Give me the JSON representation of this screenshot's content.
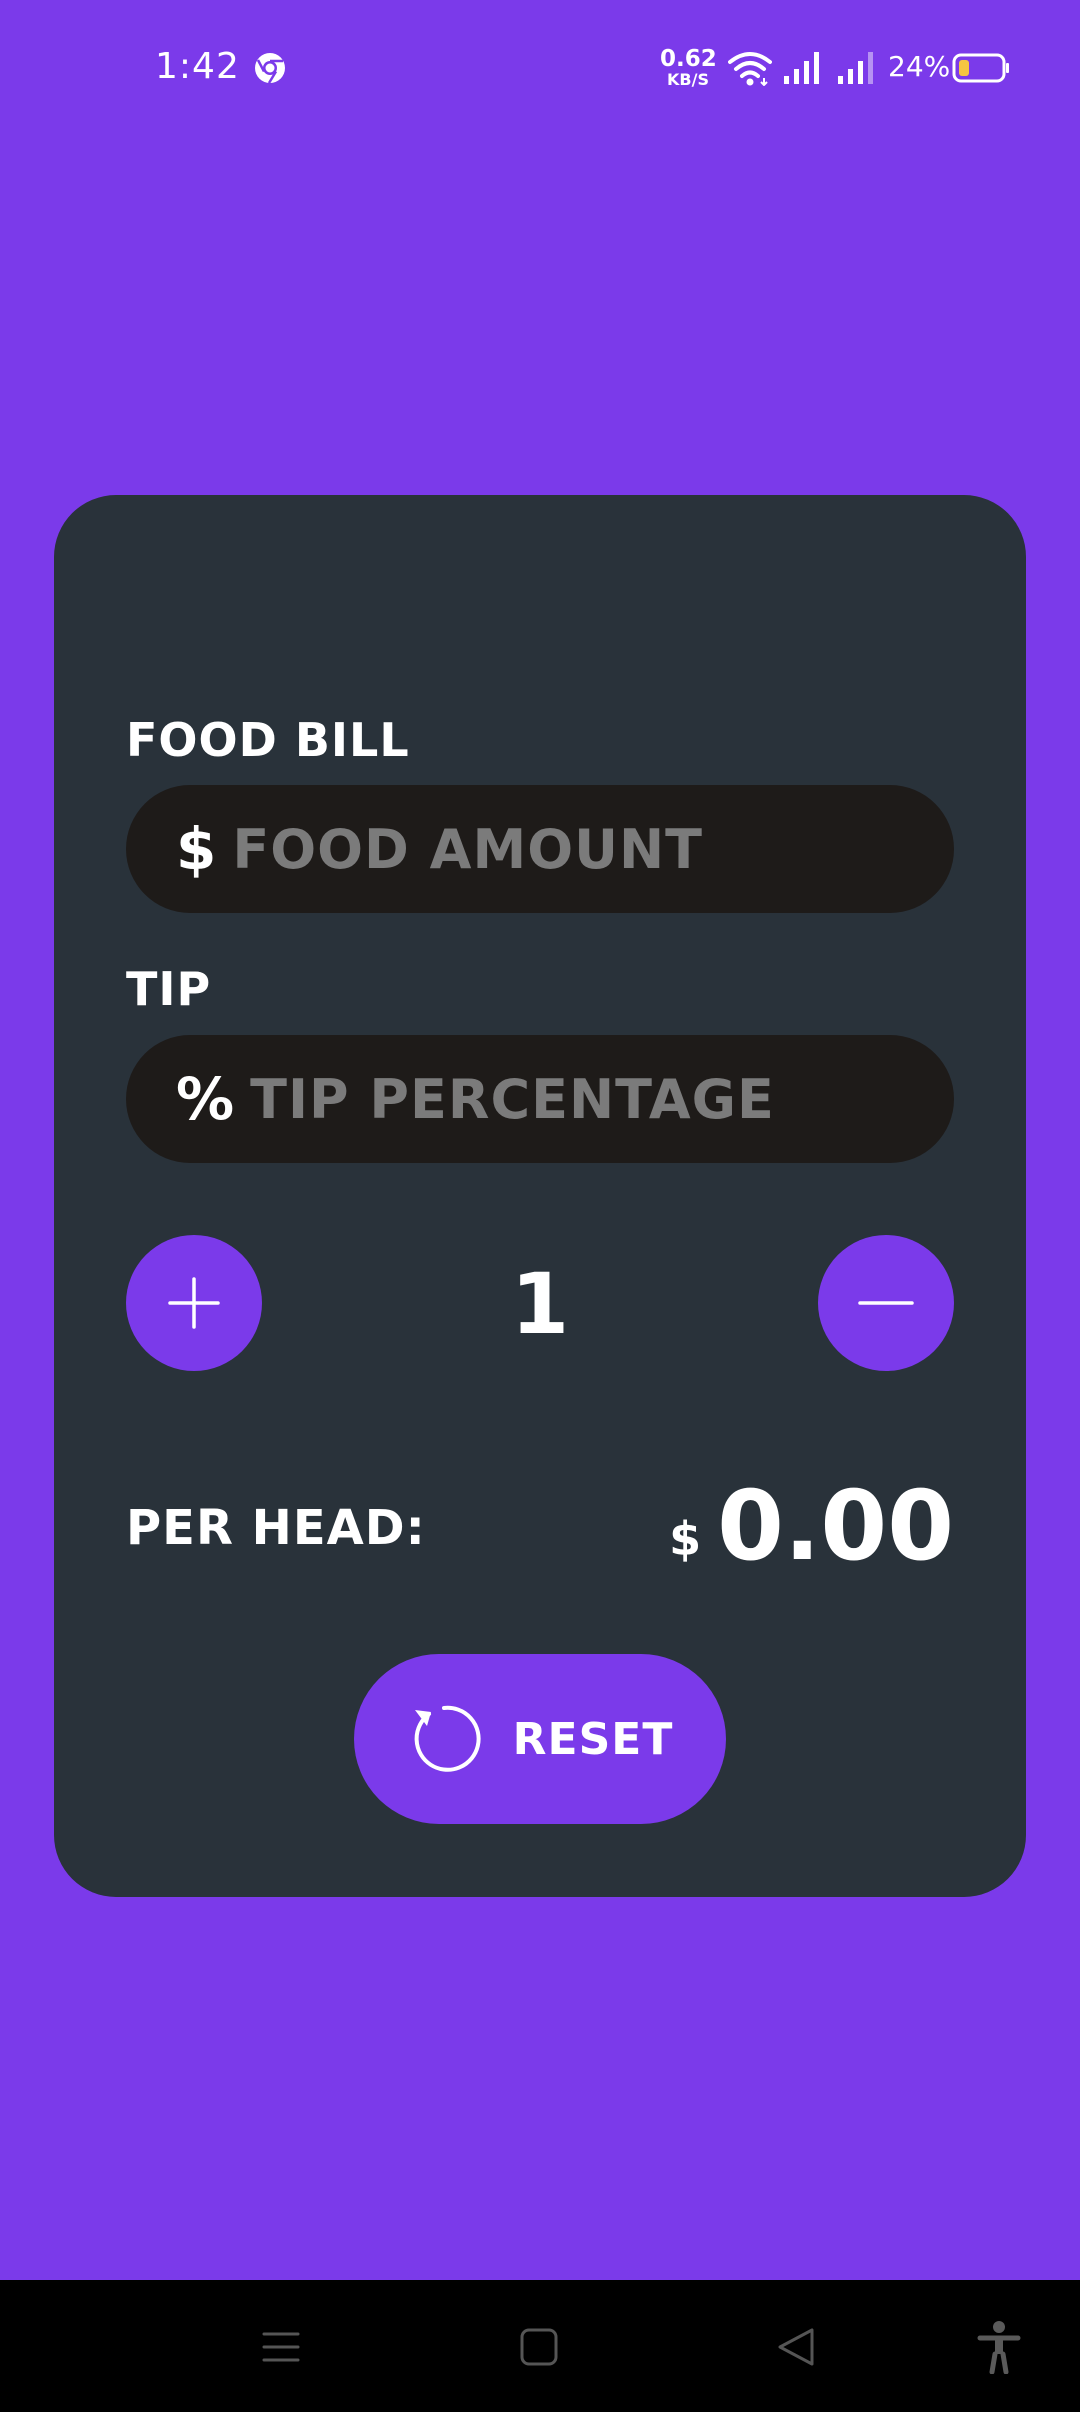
{
  "status_bar": {
    "time": "1:42",
    "network_speed_value": "0.62",
    "network_speed_unit": "KB/S",
    "battery_percent": "24%",
    "icons": [
      "chrome-icon",
      "wifi-icon",
      "signal-icon",
      "signal-icon",
      "battery-icon"
    ]
  },
  "form": {
    "food_bill_label": "FOOD BILL",
    "food_prefix": "$",
    "food_placeholder": "FOOD AMOUNT",
    "food_value": "",
    "tip_label": "TIP",
    "tip_prefix": "%",
    "tip_placeholder": "TIP PERCENTAGE",
    "tip_value": ""
  },
  "split": {
    "count": "1",
    "plus_icon": "plus-icon",
    "minus_icon": "minus-icon"
  },
  "result": {
    "per_head_label": "PER HEAD:",
    "currency": "$",
    "amount": "0.00"
  },
  "reset": {
    "label": "RESET",
    "icon": "refresh-icon"
  },
  "nav_bar": {
    "icons": [
      "menu-icon",
      "home-icon",
      "back-icon",
      "accessibility-icon"
    ]
  },
  "colors": {
    "background": "#7b3aea",
    "card": "#29323a",
    "input": "#1e1b19",
    "accent": "#7b3aea",
    "text": "#ffffff",
    "placeholder": "#7b7b7b",
    "battery_fill": "#f5c542"
  }
}
